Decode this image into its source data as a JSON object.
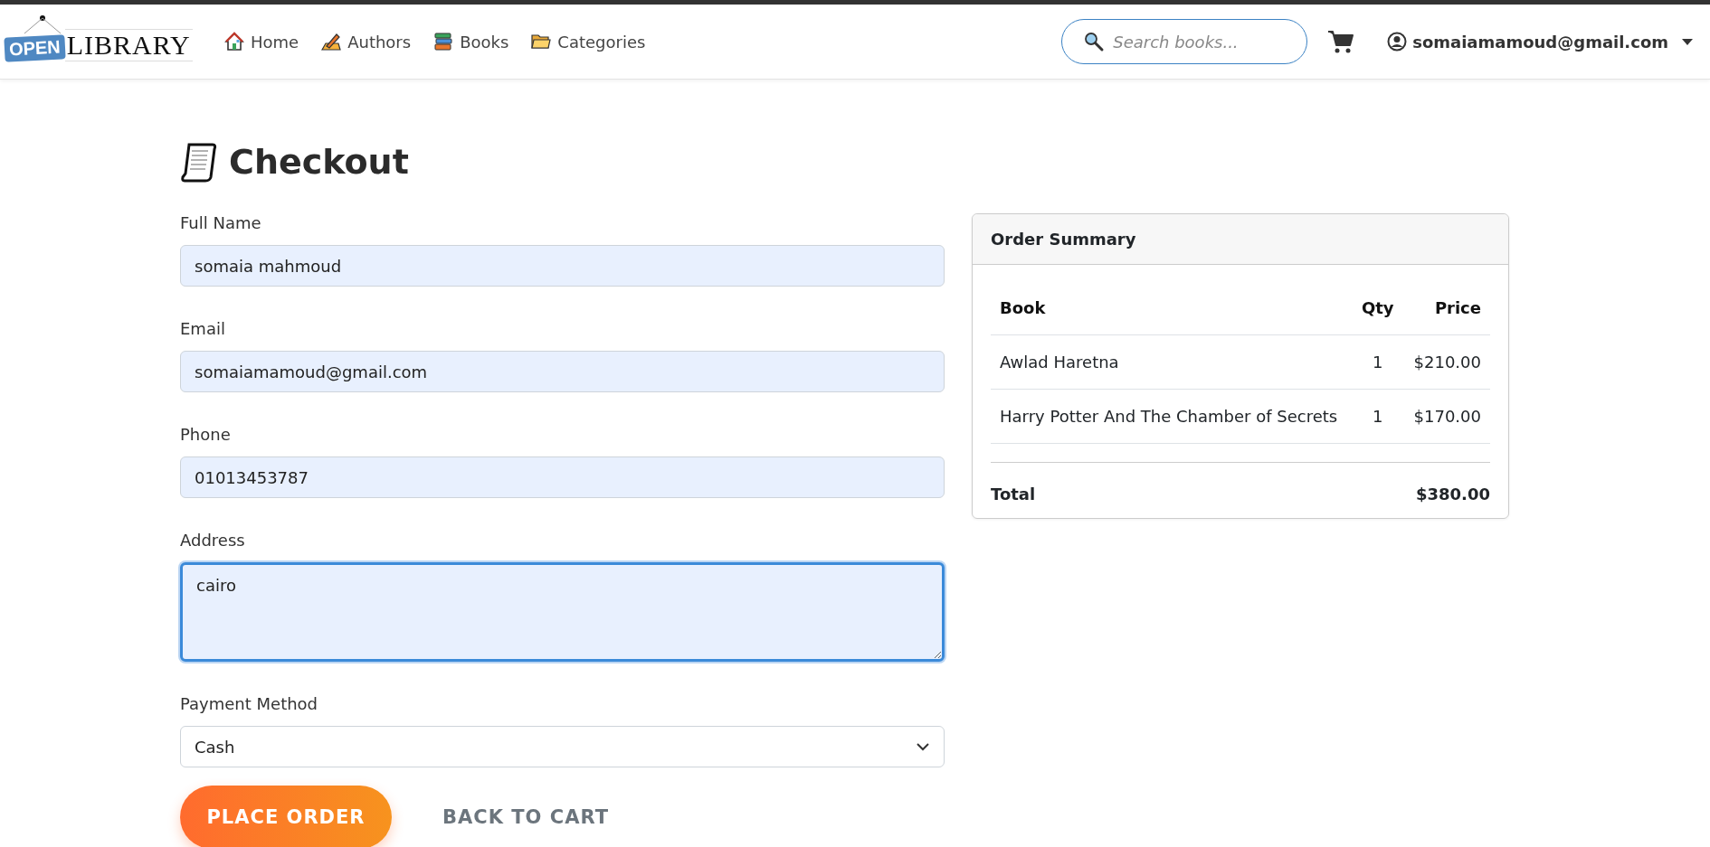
{
  "header": {
    "logo": {
      "badge": "OPEN",
      "text": "LIBRARY"
    },
    "nav": [
      {
        "label": "Home"
      },
      {
        "label": "Authors"
      },
      {
        "label": "Books"
      },
      {
        "label": "Categories"
      }
    ],
    "search": {
      "placeholder": "Search books..."
    },
    "user": {
      "email": "somaiamamoud@gmail.com"
    }
  },
  "page_title": "Checkout",
  "form": {
    "fields": [
      {
        "kind": "input",
        "label": "Full Name",
        "value": "somaia mahmoud",
        "focused": false
      },
      {
        "kind": "input",
        "label": "Email",
        "value": "somaiamamoud@gmail.com",
        "focused": false
      },
      {
        "kind": "input",
        "label": "Phone",
        "value": "01013453787",
        "focused": false
      },
      {
        "kind": "textarea",
        "label": "Address",
        "value": "cairo",
        "focused": true
      },
      {
        "kind": "select",
        "label": "Payment Method",
        "value": "Cash",
        "focused": false
      }
    ],
    "buttons": [
      {
        "kind": "primary",
        "label": "PLACE ORDER"
      },
      {
        "kind": "link",
        "label": "BACK TO CART"
      }
    ]
  },
  "order_summary": {
    "title": "Order Summary",
    "columns": [
      "Book",
      "Qty",
      "Price"
    ],
    "rows": [
      {
        "book": "Awlad Haretna",
        "qty": "1",
        "price": "$210.00"
      },
      {
        "book": "Harry Potter And The Chamber of Secrets",
        "qty": "1",
        "price": "$170.00"
      }
    ],
    "total_label": "Total",
    "total": "$380.00"
  }
}
